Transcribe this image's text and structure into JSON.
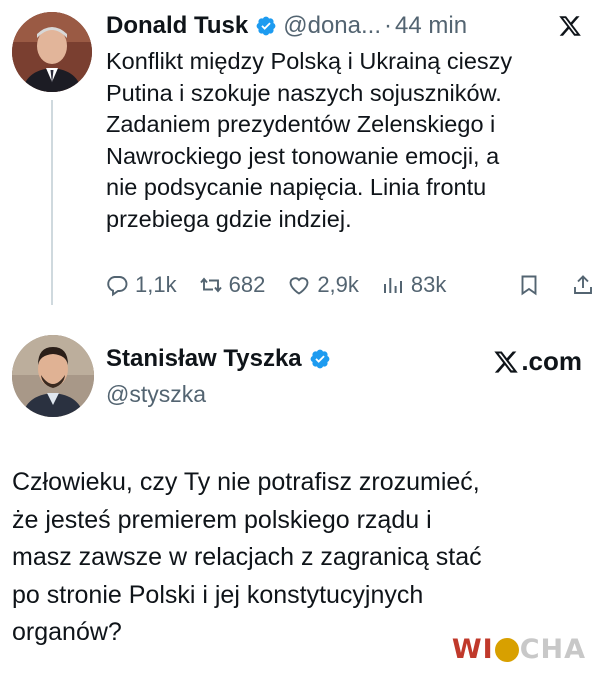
{
  "tweet1": {
    "author_name": "Donald Tusk",
    "author_handle": "@dona...",
    "separator": "·",
    "time": "44 min",
    "verified_color": "#1d9bf0",
    "platform_icon": "x-logo-icon",
    "text_lines": [
      "Konflikt między Polską i Ukrainą cieszy",
      "Putina i szokuje naszych sojuszników.",
      "Zadaniem prezydentów Zelenskiego i",
      "Nawrockiego jest tonowanie emocji, a",
      "nie podsycanie napięcia. Linia frontu",
      "przebiega gdzie indziej."
    ],
    "actions": {
      "replies": "1,1k",
      "reposts": "682",
      "likes": "2,9k",
      "views": "83k"
    }
  },
  "tweet2": {
    "author_name": "Stanisław Tyszka",
    "author_handle": "@styszka",
    "verified_color": "#1d9bf0",
    "platform_label": ".com",
    "text_lines": [
      "Człowieku, czy Ty nie potrafisz zrozumieć,",
      "że jesteś premierem polskiego rządu i",
      "masz zawsze w relacjach z zagranicą stać",
      "po stronie Polski i jej konstytucyjnych",
      "organów?"
    ]
  },
  "watermark": {
    "text_w": "W",
    "text_i": "I",
    "text_rest": "CHA"
  }
}
